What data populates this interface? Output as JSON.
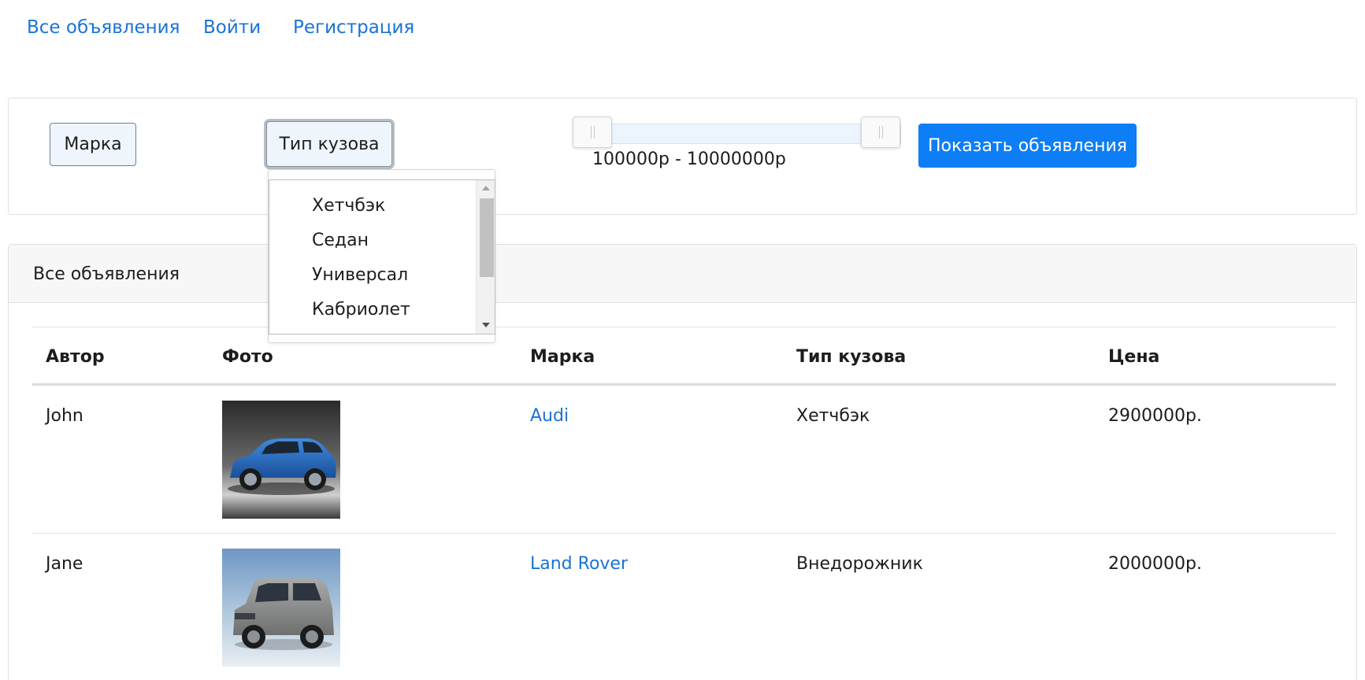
{
  "nav": {
    "all_ads": "Все объявления",
    "login": "Войти",
    "register": "Регистрация"
  },
  "filters": {
    "brand_button": "Марка",
    "body_type_button": "Тип кузова",
    "price_range_text": "100000р - 10000000р",
    "price_min": 100000,
    "price_max": 10000000,
    "show_button": "Показать объявления",
    "body_type_options": [
      "Хетчбэк",
      "Седан",
      "Универсал",
      "Кабриолет"
    ]
  },
  "list": {
    "header": "Все объявления",
    "columns": [
      "Автор",
      "Фото",
      "Марка",
      "Тип кузова",
      "Цена"
    ],
    "rows": [
      {
        "author": "John",
        "photo_icon": "blue-hatchback-car-photo",
        "brand": "Audi",
        "body_type": "Хетчбэк",
        "price": "2900000р."
      },
      {
        "author": "Jane",
        "photo_icon": "silver-suv-car-photo",
        "brand": "Land Rover",
        "body_type": "Внедорожник",
        "price": "2000000р."
      }
    ]
  },
  "colors": {
    "link": "#1a73d9",
    "primary": "#0d7ef5",
    "light_button": "#eef5fd"
  }
}
